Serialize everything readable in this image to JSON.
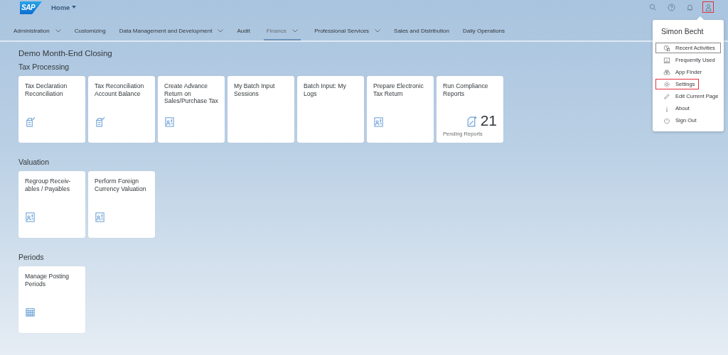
{
  "header": {
    "logo": "SAP",
    "home": "Home",
    "actions": [
      {
        "kind": "search",
        "marked": false
      },
      {
        "kind": "help",
        "marked": false
      },
      {
        "kind": "bell",
        "marked": false
      },
      {
        "kind": "user",
        "marked": true
      }
    ]
  },
  "nav": [
    {
      "label": "Administration",
      "menu": true,
      "selected": false
    },
    {
      "label": "Customizing",
      "menu": false,
      "selected": false
    },
    {
      "label": "Data Management and Development",
      "menu": true,
      "selected": false
    },
    {
      "label": "Audit",
      "menu": false,
      "selected": false
    },
    {
      "label": "Finance",
      "menu": true,
      "selected": true
    },
    {
      "label": "Professional Services",
      "menu": true,
      "selected": false
    },
    {
      "label": "Sales and Distribution",
      "menu": false,
      "selected": false
    },
    {
      "label": "Daily Operations",
      "menu": false,
      "selected": false
    }
  ],
  "page_title": "Demo Month-End Closing",
  "groups": [
    {
      "title": "Tax Processing",
      "tiles": [
        {
          "title": "Tax Declaration Reconciliation",
          "kind": "ledger"
        },
        {
          "title": "Tax Reconciliation Account Balance",
          "kind": "ledger"
        },
        {
          "title": "Create Advance Return on Sales/Purchase Tax",
          "kind": "card"
        },
        {
          "title": "My Batch Input Sessions"
        },
        {
          "title": "Batch Input: My Logs"
        },
        {
          "title": "Prepare Electronic Tax Return",
          "kind": "card"
        },
        {
          "title": "Run Compliance Reports",
          "kind": "percent",
          "value": "21",
          "footer": "Pending Reports"
        }
      ]
    },
    {
      "title": "Valuation",
      "tiles": [
        {
          "title": "Regroup Receiv-ables / Payables",
          "kind": "card"
        },
        {
          "title": "Perform Foreign Currency Valuation",
          "kind": "card"
        }
      ]
    },
    {
      "title": "Periods",
      "tiles": [
        {
          "title": "Manage Posting Periods",
          "kind": "calendar"
        }
      ]
    }
  ],
  "user_menu": {
    "name": "Simon Becht",
    "items": [
      {
        "label": "Recent Activities",
        "kind": "recent",
        "focused": true,
        "marked": false
      },
      {
        "label": "Frequently Used",
        "kind": "frequent",
        "focused": false,
        "marked": false
      },
      {
        "label": "App Finder",
        "kind": "binoculars",
        "focused": false,
        "marked": false
      },
      {
        "label": "Settings",
        "kind": "gear",
        "focused": false,
        "marked": true
      },
      {
        "label": "Edit Current Page",
        "kind": "pencil",
        "focused": false,
        "marked": false
      },
      {
        "label": "About",
        "kind": "info",
        "focused": false,
        "marked": false
      },
      {
        "label": "Sign Out",
        "kind": "power",
        "focused": false,
        "marked": false
      }
    ]
  }
}
